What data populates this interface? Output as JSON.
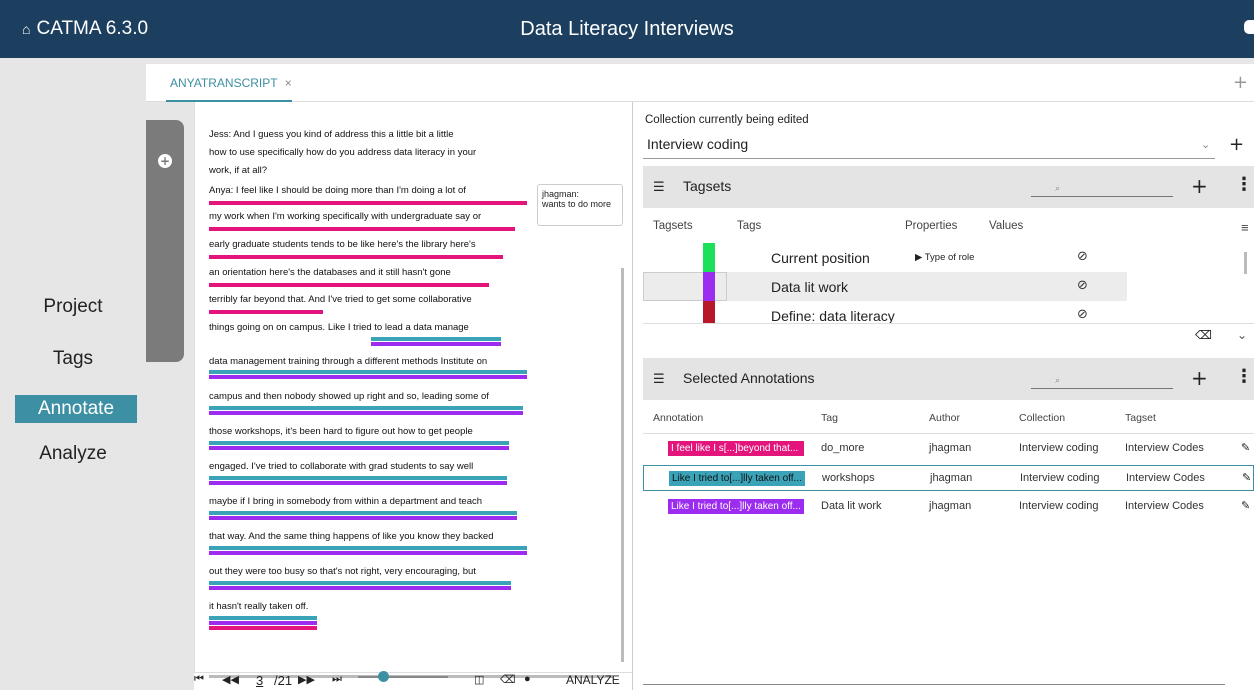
{
  "app": {
    "name": "CATMA 6.3.0",
    "project_title": "Data Literacy Interviews"
  },
  "nav": {
    "project": "Project",
    "tags": "Tags",
    "annotate": "Annotate",
    "analyze": "Analyze"
  },
  "tab": {
    "label": "ANYATRANSCRIPT",
    "close": "×",
    "add": "+"
  },
  "document": {
    "lines": [
      "Jess: And I guess you kind of address this a little bit a little",
      "how to use specifically how do you address data literacy in your",
      "work, if at all?",
      "Anya:  I feel like I should be doing more than I'm doing a lot of",
      "my work when I'm working specifically with undergraduate say or",
      "early graduate students tends to be like here's the library here's",
      " an orientation here's the databases and it still hasn't gone",
      "terribly far beyond that. And I've tried to get some collaborative",
      " things going on on campus. Like I tried to lead a data manage",
      "data management training through a different methods Institute on",
      "campus and then nobody showed up right and so, leading some of",
      "those workshops, it's  been hard to figure out how to get people",
      "engaged. I've tried to collaborate with grad students to say well",
      "maybe if I bring in somebody from within a department and teach",
      "that way. And the same thing happens of like you know they backed",
      "out they were too busy so that's not right, very encouraging, but",
      "it hasn't really taken off."
    ],
    "comment": {
      "author": "jhagman:",
      "text": "wants to do more"
    }
  },
  "pager": {
    "first": "⏮",
    "prev": "◀◀",
    "page": "3",
    "total": "/21",
    "next": "▶▶",
    "last": "⏭",
    "analyze": "ANALYZE"
  },
  "colors": {
    "pink": "#e3147c",
    "teal": "#3ba3b7",
    "purple": "#9b2cf0",
    "green": "#1de05a",
    "darkred": "#b8172a"
  },
  "collection": {
    "label": "Collection currently being edited",
    "value": "Interview coding"
  },
  "tagsets": {
    "title": "Tagsets",
    "headers": {
      "tagsets": "Tagsets",
      "tags": "Tags",
      "properties": "Properties",
      "values": "Values"
    },
    "rows": [
      {
        "name": "Current position",
        "prop": "▶ Type of role",
        "color": "#1de05a"
      },
      {
        "name": "Data lit work",
        "prop": "",
        "color": "#9b2cf0"
      },
      {
        "name": "Define: data literacy",
        "prop": "",
        "color": "#b8172a"
      }
    ]
  },
  "annotations": {
    "title": "Selected Annotations",
    "headers": {
      "annotation": "Annotation",
      "tag": "Tag",
      "author": "Author",
      "collection": "Collection",
      "tagset": "Tagset"
    },
    "rows": [
      {
        "text": "I feel like I s[...]beyond that...",
        "tag": "do_more",
        "author": "jhagman",
        "collection": "Interview coding",
        "tagset": "Interview Codes",
        "color": "#e3147c"
      },
      {
        "text": "Like I tried to[...]lly taken off...",
        "tag": "workshops",
        "author": "jhagman",
        "collection": "Interview coding",
        "tagset": "Interview Codes",
        "color": "#3ba3b7"
      },
      {
        "text": "Like I tried to[...]lly taken off...",
        "tag": "Data lit work",
        "author": "jhagman",
        "collection": "Interview coding",
        "tagset": "Interview Codes",
        "color": "#9b2cf0"
      }
    ]
  }
}
